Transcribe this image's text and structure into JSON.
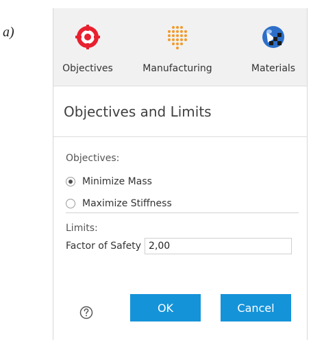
{
  "figure_label": "a)",
  "toolbar": {
    "items": [
      {
        "label": "Objectives",
        "icon": "objectives-target-icon",
        "color": "#e8202f"
      },
      {
        "label": "Manufacturing",
        "icon": "manufacturing-dots-icon",
        "color": "#f39a2a"
      },
      {
        "label": "Materials",
        "icon": "materials-sphere-icon",
        "color": "#2d6fc8"
      }
    ]
  },
  "panel": {
    "title": "Objectives and Limits"
  },
  "objectives": {
    "label": "Objectives:",
    "options": [
      {
        "label": "Minimize Mass",
        "selected": true
      },
      {
        "label": "Maximize Stiffness",
        "selected": false
      }
    ]
  },
  "limits": {
    "label": "Limits:",
    "factor_of_safety_label": "Factor of Safety",
    "factor_of_safety_value": "2,00"
  },
  "footer": {
    "help_icon": "help-icon",
    "ok_label": "OK",
    "cancel_label": "Cancel",
    "button_color": "#1593d9"
  }
}
